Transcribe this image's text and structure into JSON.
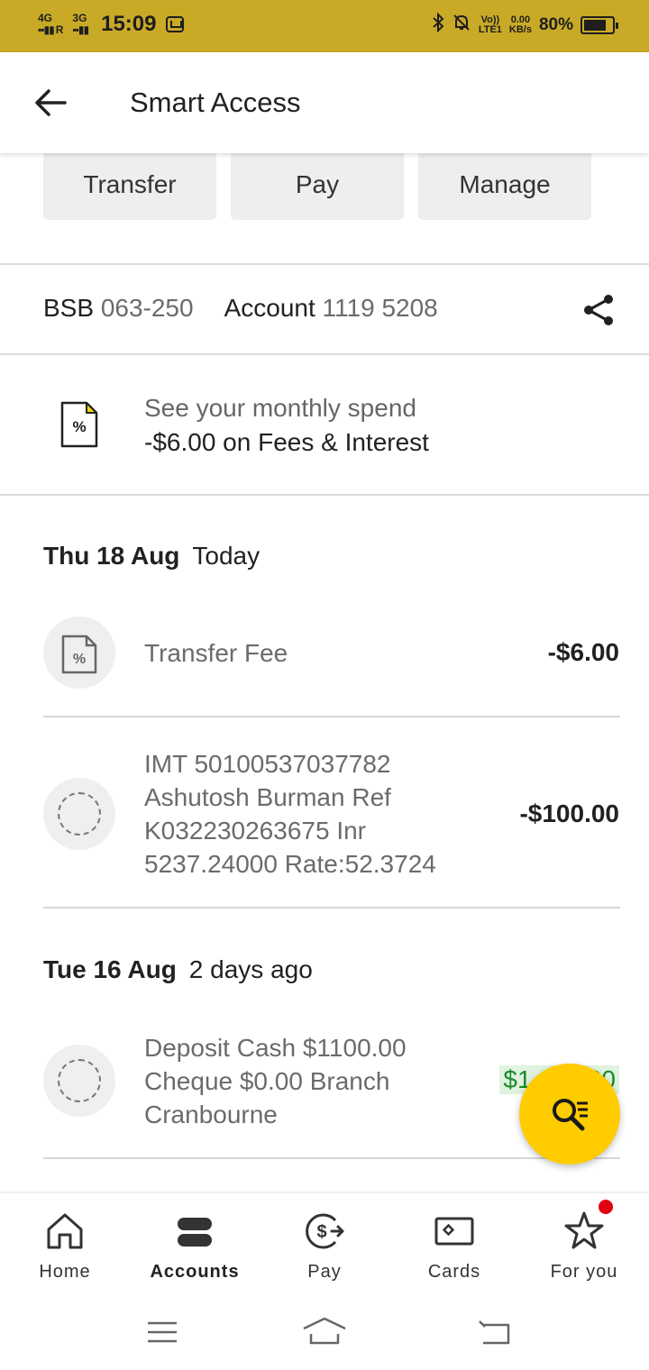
{
  "status_bar": {
    "net1": "4G",
    "net1_suffix": "R",
    "net2": "3G",
    "time": "15:09",
    "volte_top": "Vo))",
    "volte_bottom": "LTE1",
    "speed_top": "0.00",
    "speed_bottom": "KB/s",
    "battery_percent": "80%",
    "battery_level": 0.8
  },
  "app_bar": {
    "title": "Smart Access"
  },
  "actions": {
    "transfer": "Transfer",
    "pay": "Pay",
    "manage": "Manage"
  },
  "account": {
    "bsb_label": "BSB",
    "bsb_value": "063-250",
    "account_label": "Account",
    "account_value": "1119 5208"
  },
  "monthly_spend": {
    "line1": "See your monthly spend",
    "line2": "-$6.00 on Fees & Interest"
  },
  "groups": [
    {
      "date": "Thu 18 Aug",
      "relative": "Today",
      "transactions": [
        {
          "description": "Transfer Fee",
          "amount": "-$6.00"
        },
        {
          "description": "IMT 50100537037782 Ashutosh Burman Ref K032230263675 Inr 5237.24000 Rate:52.3724",
          "amount": "-$100.00"
        }
      ]
    },
    {
      "date": "Tue 16 Aug",
      "relative": "2 days ago",
      "transactions": [
        {
          "description": "Deposit Cash $1100.00 Cheque $0.00 Branch Cranbourne",
          "amount": "$1,100.00"
        }
      ]
    }
  ],
  "bottom_nav": {
    "home": "Home",
    "accounts": "Accounts",
    "pay": "Pay",
    "cards": "Cards",
    "for_you": "For you"
  },
  "colors": {
    "status_bar": "#c9aa27",
    "fab": "#ffcc00",
    "credit": "#1a8a2c",
    "badge": "#e00010"
  }
}
